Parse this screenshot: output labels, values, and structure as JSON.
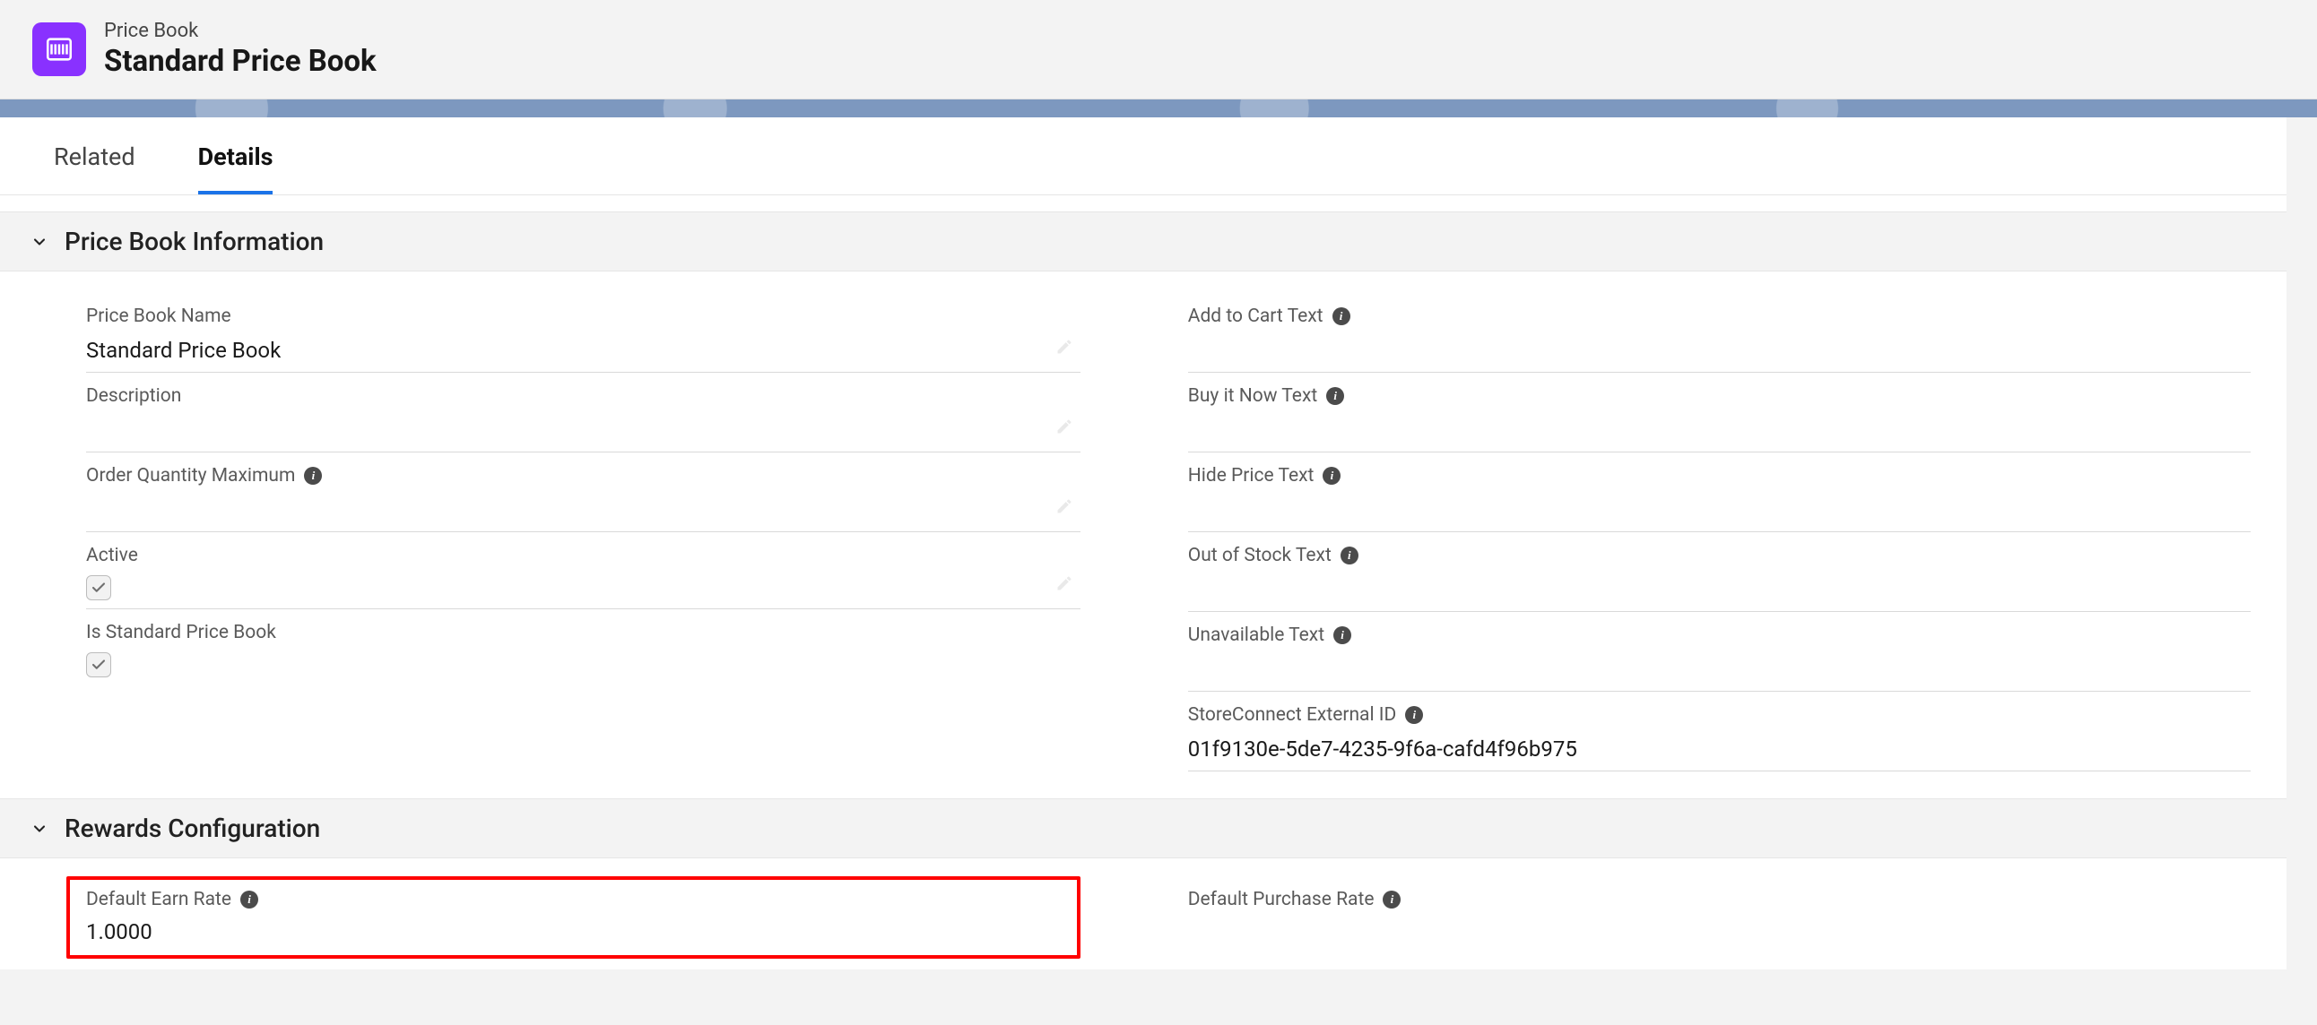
{
  "header": {
    "object_label": "Price Book",
    "record_name": "Standard Price Book"
  },
  "tabs": {
    "related": "Related",
    "details": "Details"
  },
  "sections": {
    "info": {
      "title": "Price Book Information",
      "left": {
        "name_label": "Price Book Name",
        "name_value": "Standard Price Book",
        "description_label": "Description",
        "description_value": "",
        "order_qty_max_label": "Order Quantity Maximum",
        "order_qty_max_value": "",
        "active_label": "Active",
        "active_checked": true,
        "is_standard_label": "Is Standard Price Book",
        "is_standard_checked": true
      },
      "right": {
        "add_to_cart_label": "Add to Cart Text",
        "add_to_cart_value": "",
        "buy_now_label": "Buy it Now Text",
        "buy_now_value": "",
        "hide_price_label": "Hide Price Text",
        "hide_price_value": "",
        "out_of_stock_label": "Out of Stock Text",
        "out_of_stock_value": "",
        "unavailable_label": "Unavailable Text",
        "unavailable_value": "",
        "external_id_label": "StoreConnect External ID",
        "external_id_value": "01f9130e-5de7-4235-9f6a-cafd4f96b975"
      }
    },
    "rewards": {
      "title": "Rewards Configuration",
      "left": {
        "earn_rate_label": "Default Earn Rate",
        "earn_rate_value": "1.0000"
      },
      "right": {
        "purchase_rate_label": "Default Purchase Rate",
        "purchase_rate_value": ""
      }
    }
  }
}
